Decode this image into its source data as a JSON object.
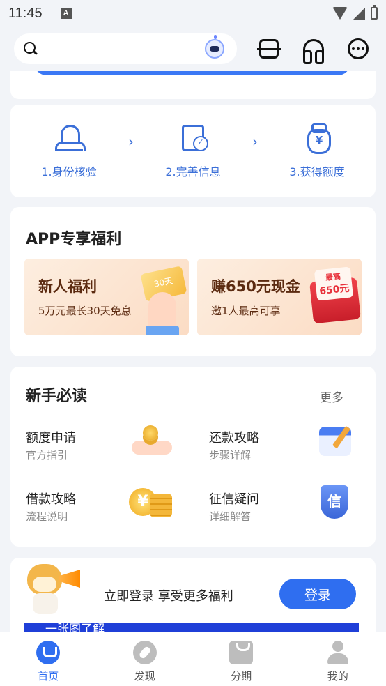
{
  "status_bar": {
    "time": "11:45",
    "notification_glyph": "A"
  },
  "header": {
    "search_placeholder": "",
    "icons": [
      "search-icon",
      "robot-assistant-icon",
      "scan-icon",
      "customer-service-icon",
      "message-icon"
    ]
  },
  "steps": [
    {
      "label": "1.身份核验",
      "icon": "identity-icon"
    },
    {
      "label": "2.完善信息",
      "icon": "document-check-icon"
    },
    {
      "label": "3.获得额度",
      "icon": "money-bag-icon"
    }
  ],
  "benefits": {
    "title": "APP专享福利",
    "promos": [
      {
        "title": "新人福利",
        "subtitle": "5万元最长30天免息",
        "ticket_text": "30天"
      },
      {
        "title": "赚650元现金",
        "subtitle": "邀1人最高可享",
        "card_top": "最高",
        "card_amount": "650元"
      }
    ]
  },
  "guide": {
    "title": "新手必读",
    "more_label": "更多",
    "items": [
      {
        "title": "额度申请",
        "subtitle": "官方指引"
      },
      {
        "title": "还款攻略",
        "subtitle": "步骤详解"
      },
      {
        "title": "借款攻略",
        "subtitle": "流程说明"
      },
      {
        "title": "征信疑问",
        "subtitle": "详细解答"
      }
    ]
  },
  "login_banner": {
    "text": "立即登录 享受更多福利",
    "button_label": "登录",
    "partial_banner_text": "一张图了解"
  },
  "bottom_nav": [
    {
      "label": "首页",
      "active": true
    },
    {
      "label": "发现",
      "active": false
    },
    {
      "label": "分期",
      "active": false
    },
    {
      "label": "我的",
      "active": false
    }
  ],
  "colors": {
    "accent": "#2f6ef0",
    "step_blue": "#3b6fd8",
    "promo_text": "#5b2a10"
  }
}
